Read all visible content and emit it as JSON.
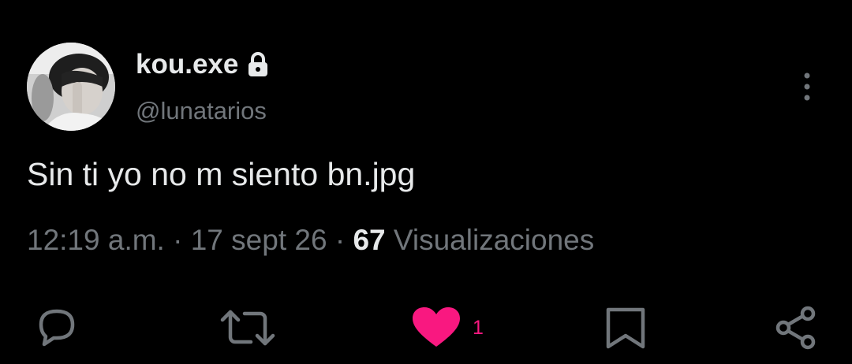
{
  "user": {
    "display_name": "kou.exe",
    "handle": "@lunatarios"
  },
  "tweet": {
    "text": "Sin ti yo no m siento bn.jpg",
    "time": "12:19 a.m.",
    "separator": "·",
    "date": "17 sept 26",
    "views_count": "67",
    "views_label": "Visualizaciones"
  },
  "actions": {
    "like_count": "1"
  },
  "colors": {
    "background": "#000000",
    "text": "#e7e9ea",
    "muted": "#71767b",
    "like": "#f91880"
  },
  "icons": [
    "lock-icon",
    "more-icon",
    "reply-icon",
    "retweet-icon",
    "heart-icon",
    "bookmark-icon",
    "share-icon"
  ]
}
